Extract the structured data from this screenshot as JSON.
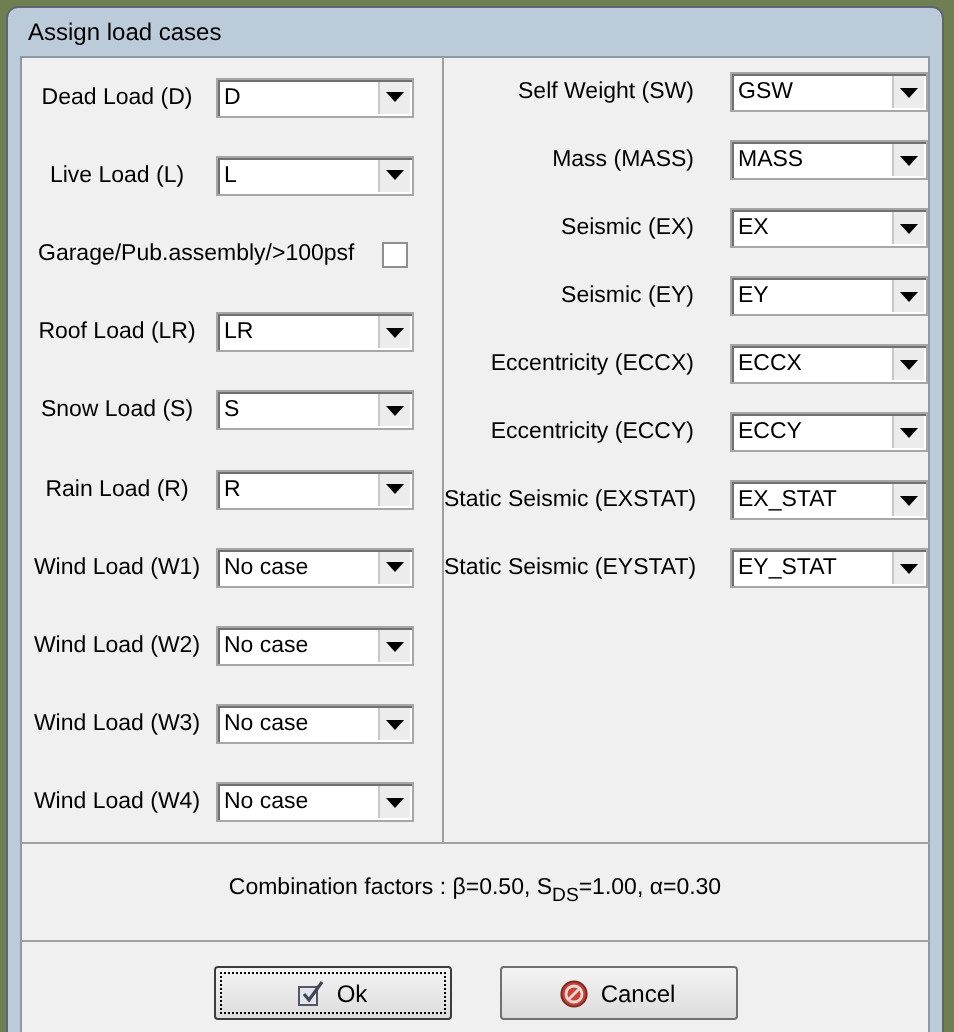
{
  "window": {
    "title": "Assign load cases"
  },
  "left_fields": [
    {
      "kind": "combo",
      "label": "Dead Load (D)",
      "value": "D"
    },
    {
      "kind": "combo",
      "label": "Live Load (L)",
      "value": "L"
    },
    {
      "kind": "checkbox",
      "label": "Garage/Pub.assembly/>100psf",
      "checked": false
    },
    {
      "kind": "combo",
      "label": "Roof Load (LR)",
      "value": "LR"
    },
    {
      "kind": "combo",
      "label": "Snow Load (S)",
      "value": "S"
    },
    {
      "kind": "combo",
      "label": "Rain Load (R)",
      "value": "R"
    },
    {
      "kind": "combo",
      "label": "Wind Load (W1)",
      "value": "No case"
    },
    {
      "kind": "combo",
      "label": "Wind Load (W2)",
      "value": "No case"
    },
    {
      "kind": "combo",
      "label": "Wind Load (W3)",
      "value": "No case"
    },
    {
      "kind": "combo",
      "label": "Wind Load (W4)",
      "value": "No case"
    }
  ],
  "right_fields": [
    {
      "kind": "combo",
      "label": "Self Weight (SW)",
      "value": "GSW"
    },
    {
      "kind": "combo",
      "label": "Mass  (MASS)",
      "value": "MASS"
    },
    {
      "kind": "combo",
      "label": "Seismic (EX)",
      "value": "EX"
    },
    {
      "kind": "combo",
      "label": "Seismic (EY)",
      "value": "EY"
    },
    {
      "kind": "combo",
      "label": "Eccentricity (ECCX)",
      "value": "ECCX"
    },
    {
      "kind": "combo",
      "label": "Eccentricity (ECCY)",
      "value": "ECCY"
    },
    {
      "kind": "combo",
      "label": "Static Seismic (EXSTAT)",
      "value": "EX_STAT"
    },
    {
      "kind": "combo",
      "label": "Static Seismic (EYSTAT)",
      "value": "EY_STAT"
    }
  ],
  "combination_factors": "Combination factors : β=0.50, S$_{DS}$=1.00, α=0.30",
  "buttons": [
    {
      "kind": "ok",
      "label": "Ok",
      "focused": true
    },
    {
      "kind": "cancel",
      "label": "Cancel",
      "focused": false
    }
  ]
}
